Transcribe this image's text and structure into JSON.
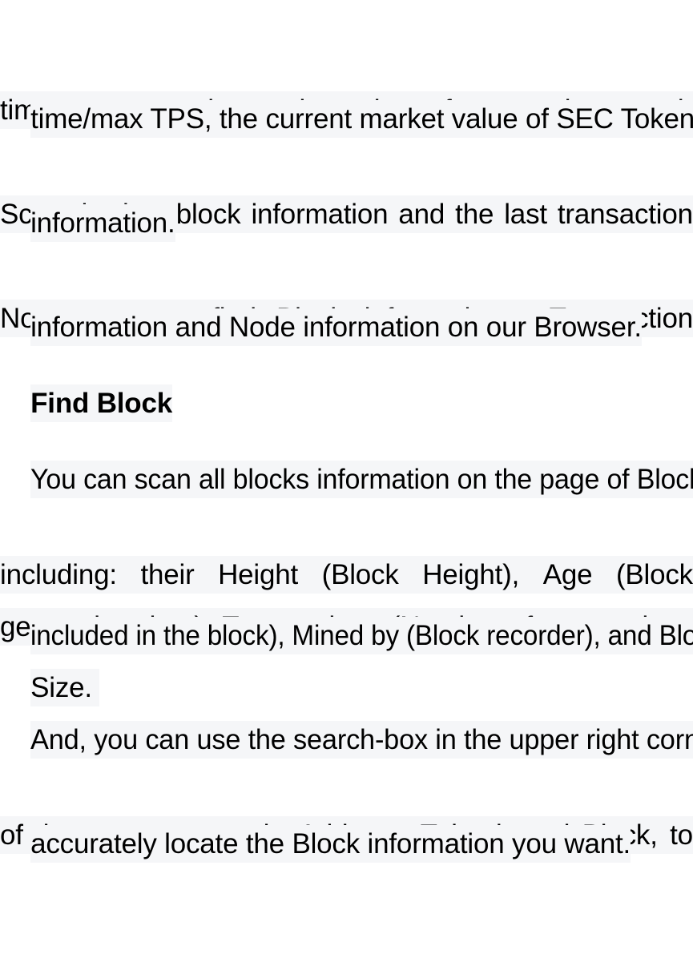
{
  "document": {
    "highlight_color": "#f5f6f8",
    "text_color": "#000000",
    "background_color": "#ffffff",
    "paragraphs": [
      {
        "id": "p1",
        "role": "body",
        "text": "time accounts, the total number of transactions, real-time/max TPS, the current market value of SEC Token."
      },
      {
        "id": "p2",
        "role": "body",
        "text": "Scan the last block information and the last transaction information."
      },
      {
        "id": "p3",
        "role": "body",
        "text": "Now, you can find Block information,  Transaction information and Node information on our Browser."
      },
      {
        "id": "h1",
        "role": "heading",
        "text": "Find Block"
      },
      {
        "id": "p4",
        "role": "body",
        "text": "You can scan all blocks information on the page of Blocks, including: their Height (Block Height), Age (Block generation time), Transactions (Number of transactions included in the block), Mined by (Block recorder), and Block Size. "
      },
      {
        "id": "p5",
        "role": "body",
        "text": "And, you can use the search-box in the upper right corner of the page to search: Address, Txhash and Block, to accurately locate the Block information you want."
      }
    ],
    "lines": {
      "l1": {
        "words": [
          "time",
          "accounts,",
          "the",
          "total",
          "number",
          "of",
          "transactions,",
          "real-"
        ]
      },
      "l2": {
        "text": "time/max TPS, the current market value of SEC Token."
      },
      "l3": {
        "words": [
          "Scan",
          "the",
          "last",
          "block",
          "information",
          "and",
          "the",
          "last",
          "transaction"
        ]
      },
      "l4": {
        "text": "information."
      },
      "l5": {
        "words": [
          "Now,",
          "you",
          "can",
          "find",
          "Block",
          "information,",
          "",
          "Transaction"
        ]
      },
      "l6": {
        "text": "information and Node information on our Browser."
      },
      "l7": {
        "text": "Find Block"
      },
      "l8": {
        "text": "You can scan all blocks information on the page of Blocks,"
      },
      "l9": {
        "words": [
          "including:",
          "their",
          "Height",
          "(Block",
          "Height),",
          "Age",
          "(Block"
        ]
      },
      "l10": {
        "words": [
          "generation",
          "time),",
          "Transactions",
          "(Number",
          "of",
          "transactions"
        ]
      },
      "l11": {
        "text": "included in the block), Mined by (Block recorder), and Block"
      },
      "l12": {
        "text": "Size. "
      },
      "l13": {
        "text": "And, you can use the search-box in the upper right corner"
      },
      "l14": {
        "words": [
          "of",
          "the",
          "page",
          "to",
          "search:",
          "Address,",
          "Txhash",
          "and",
          "Block,",
          "to"
        ]
      },
      "l15": {
        "text": "accurately locate the Block information you want."
      }
    }
  }
}
